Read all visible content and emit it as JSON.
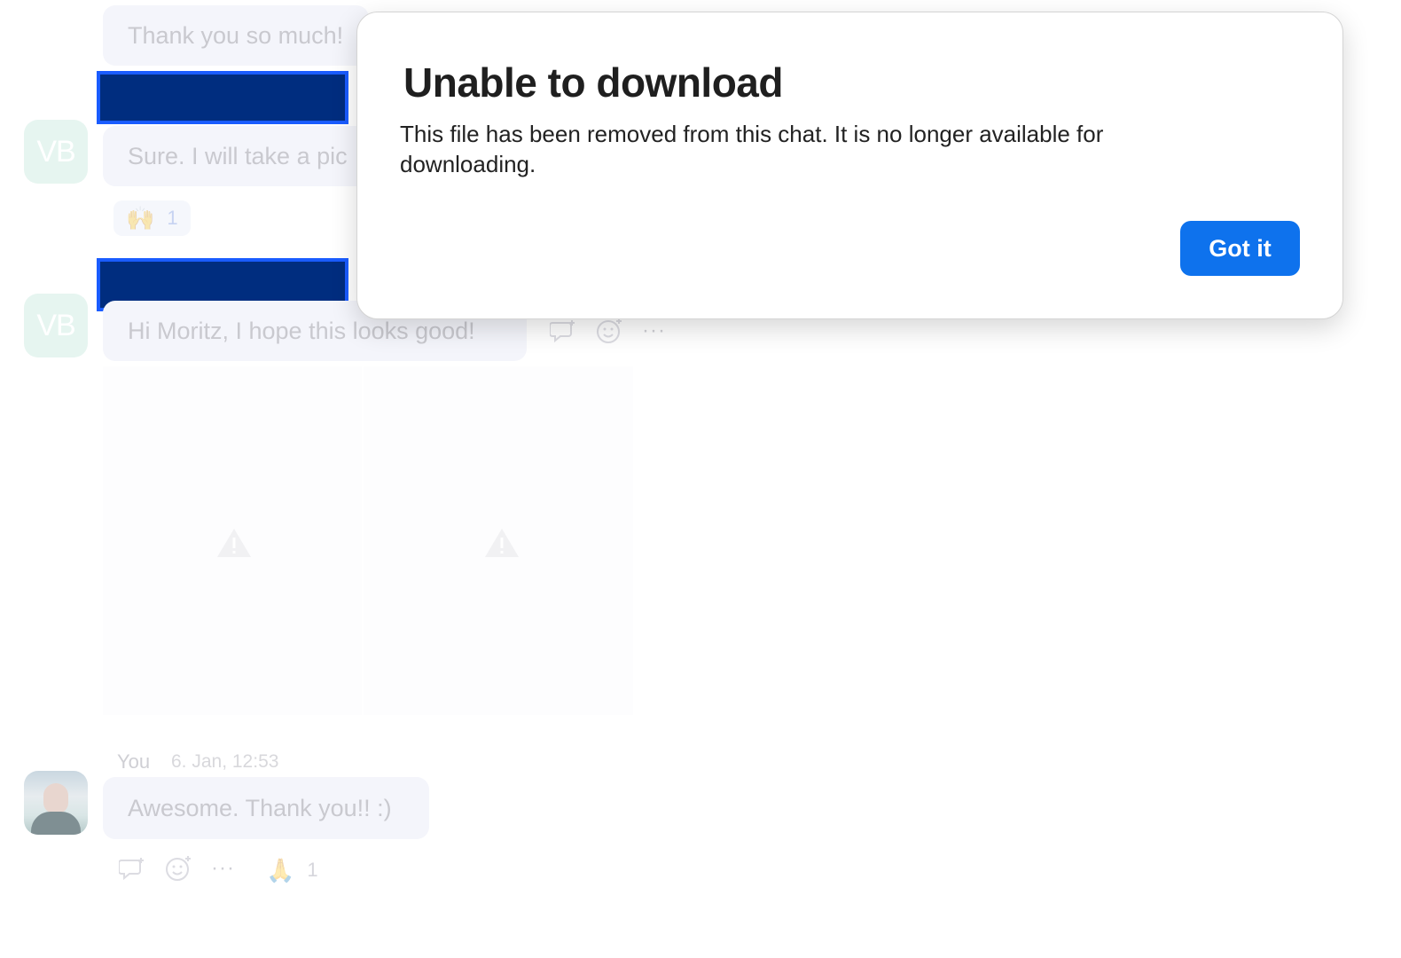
{
  "background_chat": {
    "messages": [
      {
        "text": "Thank you so much!"
      },
      {
        "avatar_initials": "VB",
        "text": "Sure. I will take a pic"
      },
      {
        "avatar_initials": "VB",
        "text": "Hi Moritz, I hope this looks good!"
      }
    ],
    "reaction_1": {
      "emoji": "🙌",
      "count": "1"
    },
    "you_message": {
      "sender": "You",
      "timestamp": "6. Jan, 12:53",
      "text": "Awesome. Thank you!! :)",
      "reaction": {
        "emoji": "🙏",
        "count": "1"
      }
    },
    "more_label": "···",
    "icons": [
      "thread-reply-icon",
      "add-reaction-icon",
      "more-options-icon",
      "warning-icon"
    ]
  },
  "dialog": {
    "title": "Unable to download",
    "message": "This file has been removed from this chat. It is no longer available for downloading.",
    "confirm_label": "Got it"
  },
  "colors": {
    "primary": "#0e72ed",
    "redaction_fill": "#002d7f",
    "redaction_border": "#1a5cff"
  }
}
